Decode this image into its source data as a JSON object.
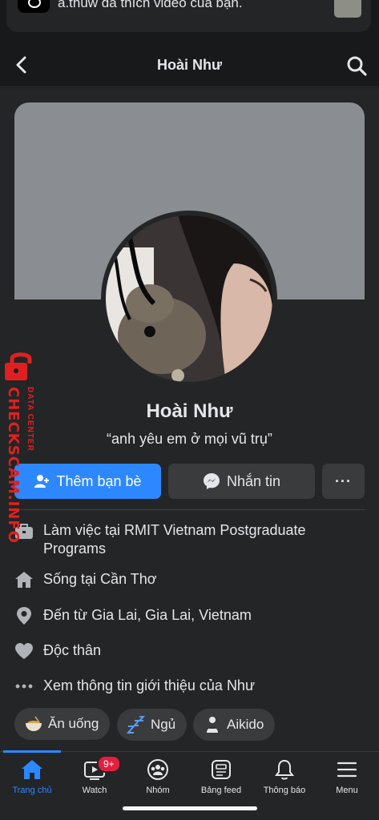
{
  "notification": {
    "text": "a.thuw đã thích video của bạn."
  },
  "header": {
    "title": "Hoài Như"
  },
  "profile": {
    "name": "Hoài Như",
    "bio": "“anh yêu em ở mọi vũ trụ”"
  },
  "actions": {
    "add_friend": "Thêm bạn bè",
    "message": "Nhắn tin",
    "more": "···"
  },
  "intro": {
    "work_prefix": "Làm việc tại ",
    "work_place": "RMIT Vietnam Postgraduate Programs",
    "lives_prefix": "Sống tại ",
    "lives_place": "Cần Thơ",
    "from_prefix": "Đến từ ",
    "from_place": "Gia Lai, Gia Lai, Vietnam",
    "relationship": "Độc thân",
    "see_more": "Xem thông tin giới thiệu của Như"
  },
  "hobbies": [
    {
      "label": "Ăn uống",
      "icon": "bowl-icon"
    },
    {
      "label": "Ngủ",
      "icon": "sleep-icon"
    },
    {
      "label": "Aikido",
      "icon": "martial-arts-icon"
    }
  ],
  "tabbar": {
    "home": "Trang chủ",
    "watch": "Watch",
    "watch_badge": "9+",
    "groups": "Nhóm",
    "feed": "Bảng feed",
    "notifications": "Thông báo",
    "menu": "Menu"
  },
  "watermark": {
    "main": "CHECKSCAM.INFO",
    "sub": "DATA CENTER"
  },
  "colors": {
    "accent": "#2d88ff",
    "background": "#18191a",
    "surface": "#242526",
    "badge": "#e41e3f",
    "watermark": "#e02020"
  }
}
